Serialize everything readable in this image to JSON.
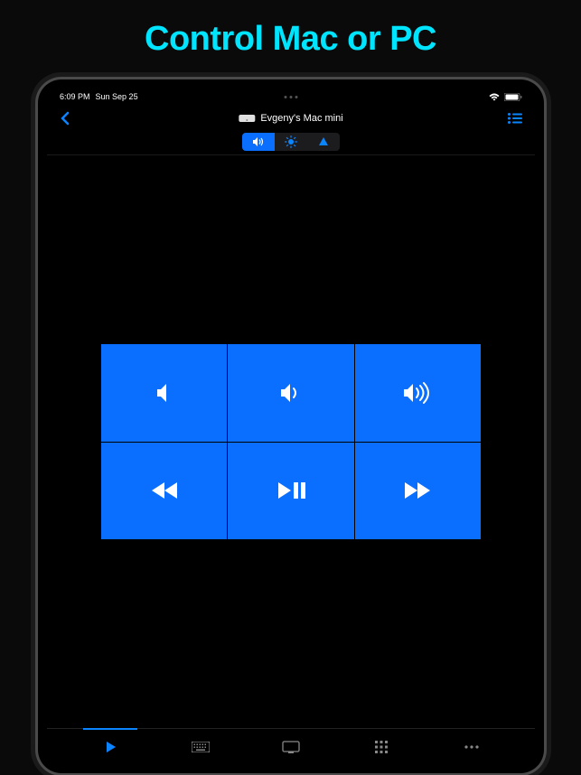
{
  "marketing": {
    "title": "Control Mac or PC"
  },
  "statusBar": {
    "time": "6:09 PM",
    "date": "Sun Sep 25"
  },
  "nav": {
    "deviceName": "Evgeny's Mac mini"
  },
  "segments": {
    "volume": "volume",
    "brightness": "brightness",
    "cursor": "cursor"
  },
  "controls": {
    "mute": "Mute",
    "volDown": "Volume Down",
    "volUp": "Volume Up",
    "rewind": "Rewind",
    "playPause": "Play/Pause",
    "forward": "Forward"
  },
  "tabs": {
    "play": "Play",
    "keyboard": "Keyboard",
    "display": "Display",
    "apps": "Apps",
    "more": "More"
  }
}
